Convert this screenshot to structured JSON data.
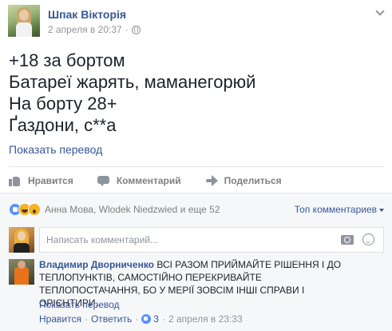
{
  "post": {
    "author": "Шпак Вікторія",
    "timestamp": "2 апреля в 20:37",
    "separator": "·",
    "lines": [
      "+18 за бортом",
      "Батареї жарять, маманегорюй",
      "На борту 28+",
      "Ґаздони, с**а"
    ],
    "translate_link": "Показать перевод"
  },
  "actions": {
    "like": "Нравится",
    "comment": "Комментарий",
    "share": "Поделиться"
  },
  "reactions": {
    "icons": [
      "like-reaction-icon",
      "haha-reaction-icon",
      "wow-reaction-icon"
    ],
    "summary": "Анна Мова, Wlodek Niedzwied и еще 52",
    "sort_label": "Топ комментариев"
  },
  "comment_input": {
    "placeholder": "Написать комментарий..."
  },
  "comment": {
    "author": "Владимир Дворниченко",
    "text": "ВСІ РАЗОМ ПРИЙМАЙТЕ РІШЕННЯ І ДО ТЕПЛОПУНКТІВ, САМОСТІЙНО ПЕРЕКРИВАЙТЕ ТЕПЛОПОСТАЧАННЯ, БО У МЕРІЇ ЗОВСІМ ІНШІ СПРАВИ І ОРІЄНТИРИ..",
    "translate_link": "Показать перевод",
    "like_label": "Нравится",
    "reply_label": "Ответить",
    "like_count": "3",
    "timestamp": "2 апреля в 23:33",
    "separator": "·"
  },
  "colors": {
    "link": "#365899",
    "meta": "#90949c",
    "comments_bg": "#f6f7f9",
    "like_blue": "#5890ff"
  }
}
